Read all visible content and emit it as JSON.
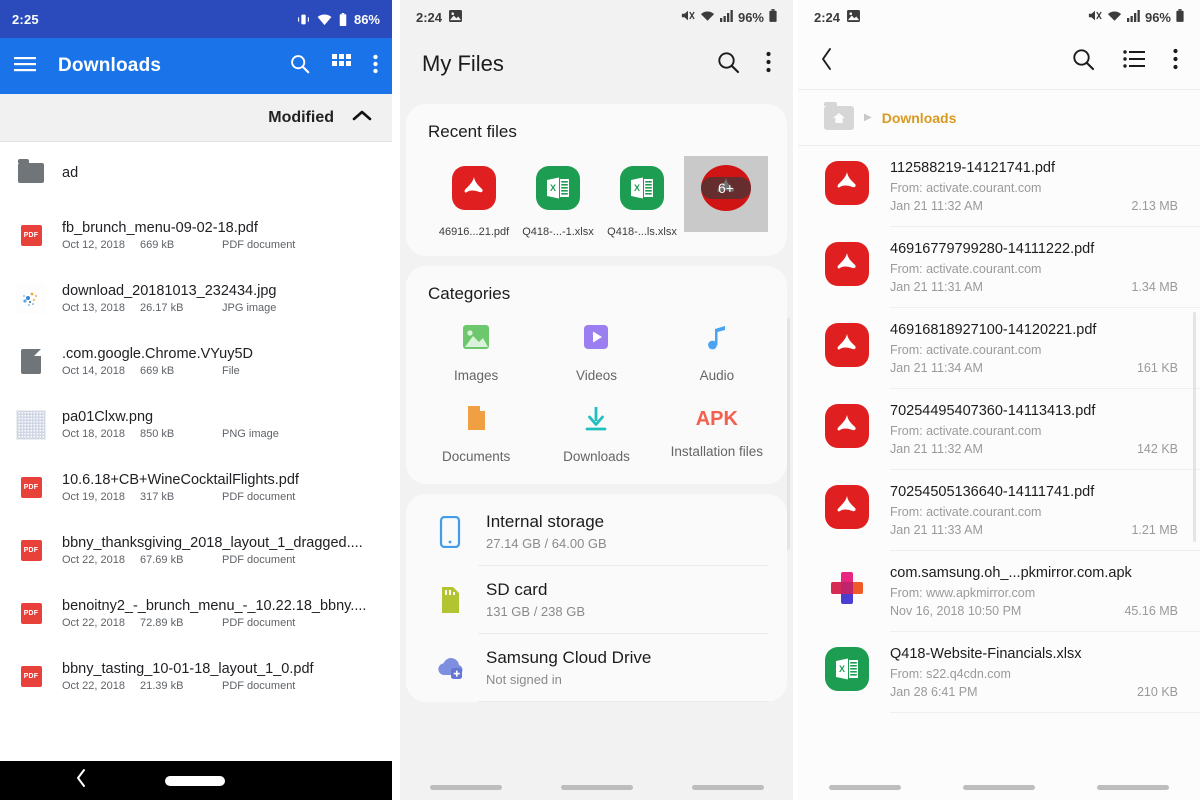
{
  "panel1": {
    "status": {
      "time": "2:25",
      "battery": "86%",
      "icons": [
        "vibrate-icon",
        "wifi-icon",
        "battery-icon"
      ]
    },
    "toolbar": {
      "title": "Downloads",
      "menu_icon": "hamburger-menu-icon",
      "search_icon": "search-icon",
      "grid_icon": "grid-view-icon",
      "overflow_icon": "overflow-menu-icon",
      "bg": "#1a73e8"
    },
    "sortbar": {
      "label": "Modified",
      "chevron": "chevron-up-icon"
    },
    "files": [
      {
        "name": "ad",
        "date": "",
        "size": "",
        "type": "",
        "icon": "folder-icon"
      },
      {
        "name": "fb_brunch_menu-09-02-18.pdf",
        "date": "Oct 12, 2018",
        "size": "669 kB",
        "type": "PDF document",
        "icon": "pdf-icon"
      },
      {
        "name": "download_20181013_232434.jpg",
        "date": "Oct 13, 2018",
        "size": "26.17 kB",
        "type": "JPG image",
        "icon": "jpg-thumbnail"
      },
      {
        "name": ".com.google.Chrome.VYuy5D",
        "date": "Oct 14, 2018",
        "size": "669 kB",
        "type": "File",
        "icon": "generic-file-icon"
      },
      {
        "name": "pa01Clxw.png",
        "date": "Oct 18, 2018",
        "size": "850 kB",
        "type": "PNG image",
        "icon": "png-thumbnail"
      },
      {
        "name": "10.6.18+CB+WineCocktailFlights.pdf",
        "date": "Oct 19, 2018",
        "size": "317 kB",
        "type": "PDF document",
        "icon": "pdf-icon"
      },
      {
        "name": "bbny_thanksgiving_2018_layout_1_dragged....",
        "date": "Oct 22, 2018",
        "size": "67.69 kB",
        "type": "PDF document",
        "icon": "pdf-icon"
      },
      {
        "name": "benoitny2_-_brunch_menu_-_10.22.18_bbny....",
        "date": "Oct 22, 2018",
        "size": "72.89 kB",
        "type": "PDF document",
        "icon": "pdf-icon"
      },
      {
        "name": "bbny_tasting_10-01-18_layout_1_0.pdf",
        "date": "Oct 22, 2018",
        "size": "21.39 kB",
        "type": "PDF document",
        "icon": "pdf-icon"
      }
    ],
    "navbar": {
      "back_icon": "back-chevron-icon",
      "home_pill": "home-pill-icon"
    }
  },
  "panel2": {
    "status": {
      "time": "2:24",
      "battery": "96%",
      "icons": [
        "image-icon",
        "mute-icon",
        "wifi-icon",
        "signal-icon",
        "battery-icon"
      ]
    },
    "appbar": {
      "title": "My Files",
      "search_icon": "search-icon",
      "overflow_icon": "overflow-menu-icon"
    },
    "recent": {
      "heading": "Recent files",
      "tiles": [
        {
          "label": "46916...21.pdf",
          "icon": "pdf-icon"
        },
        {
          "label": "Q418-...-1.xlsx",
          "icon": "xlsx-icon"
        },
        {
          "label": "Q418-...ls.xlsx",
          "icon": "xlsx-icon"
        },
        {
          "label": "",
          "icon": "pdf-icon",
          "badge": "6+"
        }
      ]
    },
    "categories": {
      "heading": "Categories",
      "items": [
        {
          "label": "Images",
          "icon": "image-icon",
          "color": "#6dc86d"
        },
        {
          "label": "Videos",
          "icon": "video-icon",
          "color": "#9b7ff0"
        },
        {
          "label": "Audio",
          "icon": "audio-note-icon",
          "color": "#4aa3f0"
        },
        {
          "label": "Documents",
          "icon": "document-icon",
          "color": "#f0a043"
        },
        {
          "label": "Downloads",
          "icon": "download-arrow-icon",
          "color": "#1fbfc0"
        },
        {
          "label": "Installation files",
          "icon": "apk-icon",
          "color": "#f3604d"
        }
      ]
    },
    "storage": [
      {
        "title": "Internal storage",
        "sub": "27.14 GB / 64.00 GB",
        "icon": "phone-icon",
        "color": "#3f9dec"
      },
      {
        "title": "SD card",
        "sub": "131 GB / 238 GB",
        "icon": "sdcard-icon",
        "color": "#b3c432"
      },
      {
        "title": "Samsung Cloud Drive",
        "sub": "Not signed in",
        "icon": "cloud-icon",
        "color": "#7e8fe0"
      }
    ]
  },
  "panel3": {
    "status": {
      "time": "2:24",
      "battery": "96%",
      "icons": [
        "image-icon",
        "mute-icon",
        "wifi-icon",
        "signal-icon",
        "battery-icon"
      ]
    },
    "appbar": {
      "back_icon": "back-chevron-icon",
      "search_icon": "search-icon",
      "list_icon": "list-view-icon",
      "overflow_icon": "overflow-menu-icon"
    },
    "breadcrumb": {
      "home_icon": "home-folder-icon",
      "arrow_icon": "caret-right-icon",
      "label": "Downloads",
      "color": "#d99a20"
    },
    "files": [
      {
        "name": "112588219-14121741.pdf",
        "from": "From: activate.courant.com",
        "date": "Jan 21 11:32 AM",
        "size": "2.13 MB",
        "icon": "pdf-icon"
      },
      {
        "name": "46916779799280-14111222.pdf",
        "from": "From: activate.courant.com",
        "date": "Jan 21 11:31 AM",
        "size": "1.34 MB",
        "icon": "pdf-icon"
      },
      {
        "name": "46916818927100-14120221.pdf",
        "from": "From: activate.courant.com",
        "date": "Jan 21 11:34 AM",
        "size": "161 KB",
        "icon": "pdf-icon"
      },
      {
        "name": "70254495407360-14113413.pdf",
        "from": "From: activate.courant.com",
        "date": "Jan 21 11:32 AM",
        "size": "142 KB",
        "icon": "pdf-icon"
      },
      {
        "name": "70254505136640-14111741.pdf",
        "from": "From: activate.courant.com",
        "date": "Jan 21 11:33 AM",
        "size": "1.21 MB",
        "icon": "pdf-icon"
      },
      {
        "name": "com.samsung.oh_...pkmirror.com.apk",
        "from": "From: www.apkmirror.com",
        "date": "Nov 16, 2018 10:50 PM",
        "size": "45.16 MB",
        "icon": "apk-icon"
      },
      {
        "name": "Q418-Website-Financials.xlsx",
        "from": "From: s22.q4cdn.com",
        "date": "Jan 28 6:41 PM",
        "size": "210 KB",
        "icon": "xlsx-icon"
      }
    ]
  }
}
